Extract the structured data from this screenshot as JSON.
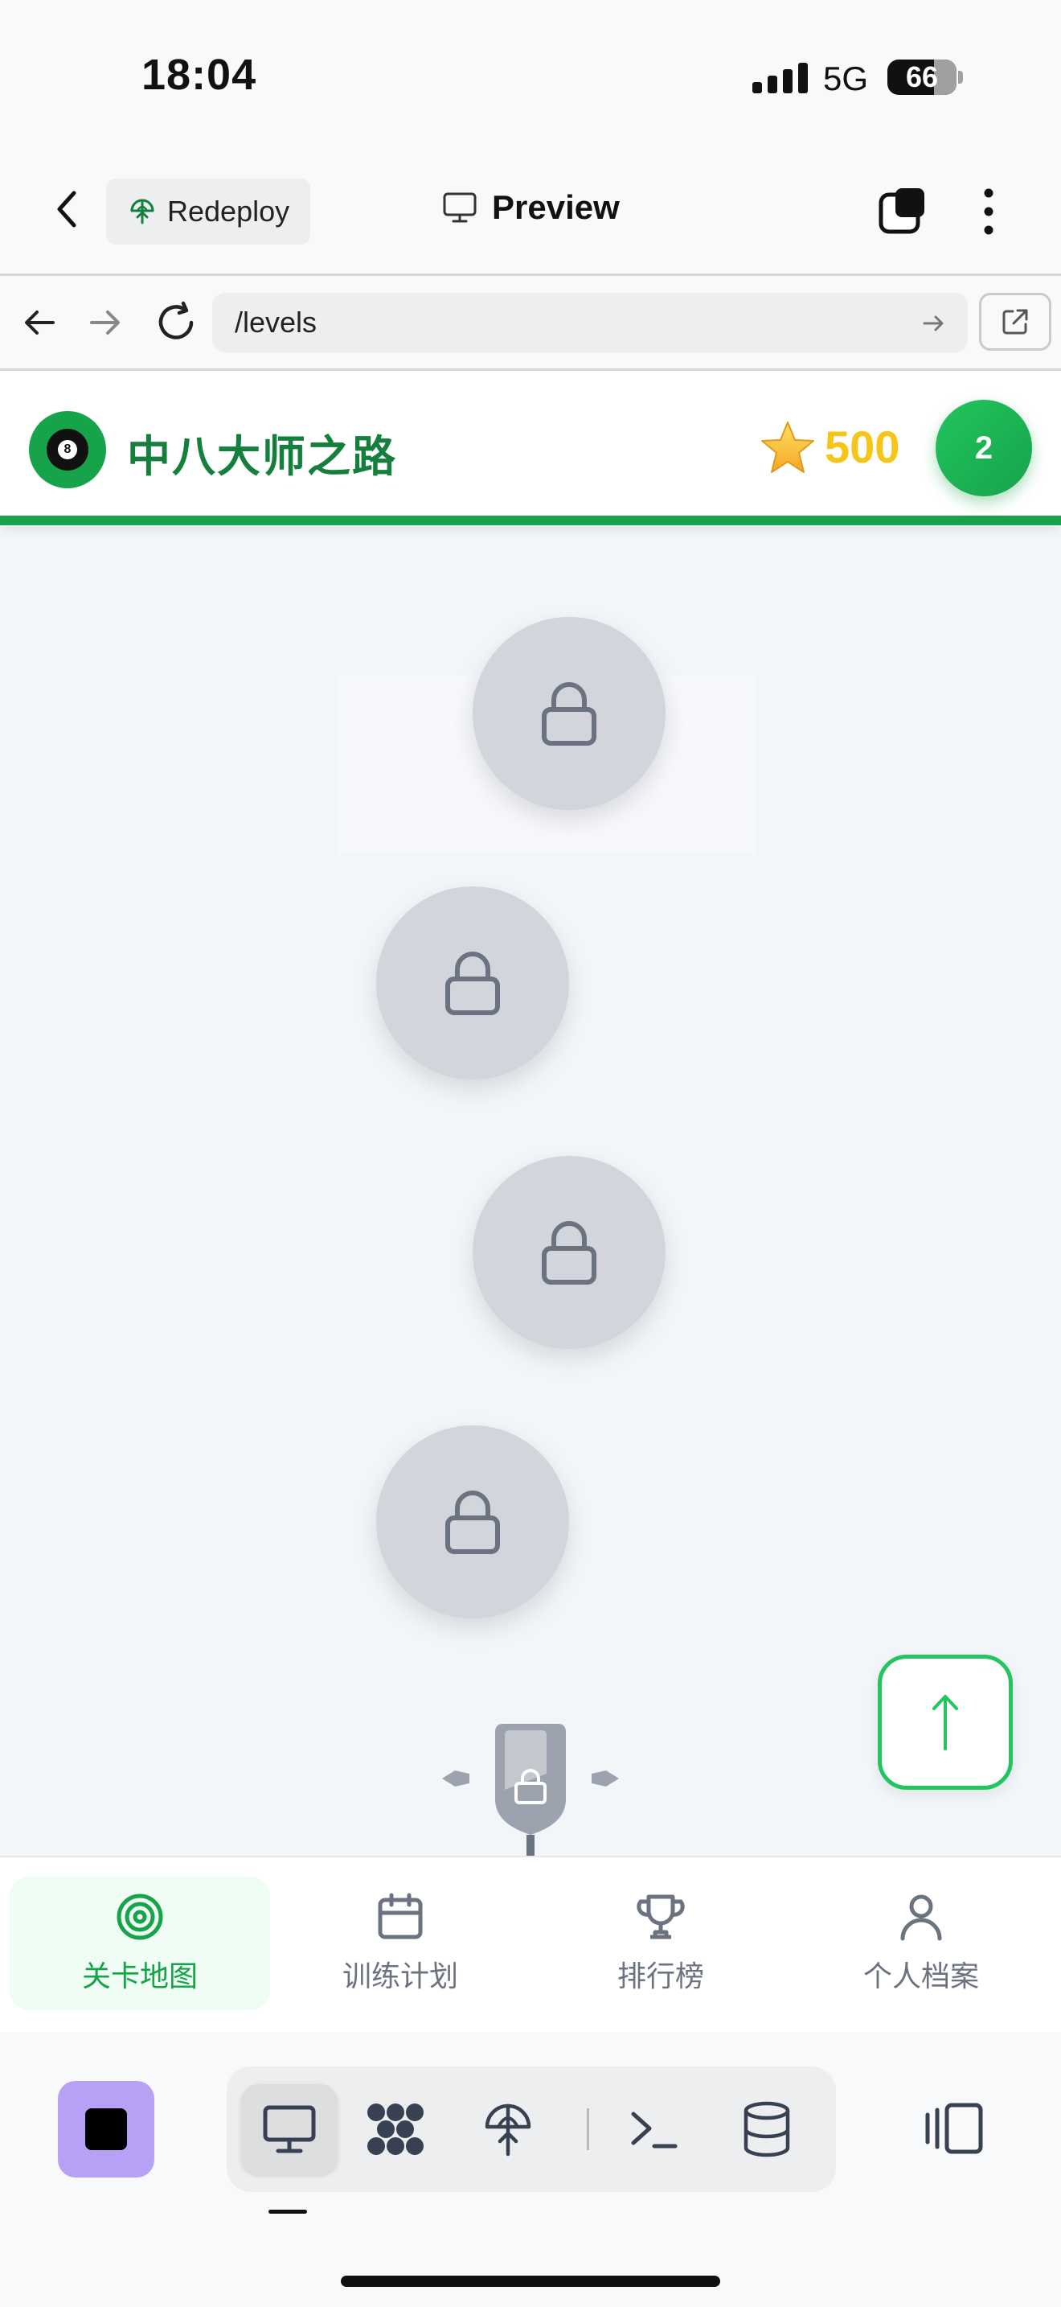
{
  "status_bar": {
    "time": "18:04",
    "network": "5G",
    "battery": "66"
  },
  "app_header": {
    "redeploy_label": "Redeploy",
    "preview_label": "Preview"
  },
  "browser": {
    "url": "/levels"
  },
  "site": {
    "title": "中八大师之路",
    "points": "500",
    "level": "2",
    "accent_color": "#16a34a",
    "star_color": "#f5c518"
  },
  "level_nodes": [
    {
      "state": "locked",
      "icon": "lock-icon"
    },
    {
      "state": "locked",
      "icon": "lock-icon"
    },
    {
      "state": "locked",
      "icon": "lock-icon"
    },
    {
      "state": "locked",
      "icon": "lock-icon"
    },
    {
      "state": "locked",
      "icon": "boss-lock-icon"
    }
  ],
  "tabs": [
    {
      "label": "关卡地图",
      "icon": "target-icon",
      "active": true
    },
    {
      "label": "训练计划",
      "icon": "calendar-icon",
      "active": false
    },
    {
      "label": "排行榜",
      "icon": "trophy-icon",
      "active": false
    },
    {
      "label": "个人档案",
      "icon": "user-icon",
      "active": false
    }
  ],
  "dev_toolbar": {
    "tools": [
      "monitor-icon",
      "agent-icon",
      "deploy-icon",
      "terminal-icon",
      "database-icon"
    ],
    "active_tool": "monitor-icon"
  }
}
